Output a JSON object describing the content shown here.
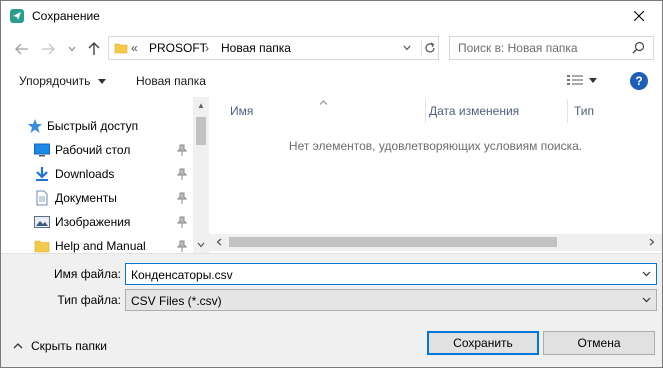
{
  "window": {
    "title": "Сохранение"
  },
  "address": {
    "crumbs": [
      "PROSOFT",
      "Новая папка"
    ]
  },
  "search": {
    "placeholder": "Поиск в: Новая папка"
  },
  "toolbar": {
    "organize_label": "Упорядочить",
    "new_folder_label": "Новая папка"
  },
  "nav": {
    "items": [
      {
        "label": "Быстрый доступ",
        "icon": "star-icon",
        "pinned": false
      },
      {
        "label": "Рабочий стол",
        "icon": "desktop-icon",
        "pinned": true
      },
      {
        "label": "Downloads",
        "icon": "download-arrow-icon",
        "pinned": true
      },
      {
        "label": "Документы",
        "icon": "documents-icon",
        "pinned": true
      },
      {
        "label": "Изображения",
        "icon": "pictures-icon",
        "pinned": true
      },
      {
        "label": "Help and Manual",
        "icon": "folder-icon",
        "pinned": true
      }
    ]
  },
  "filelist": {
    "columns": [
      "Имя",
      "Дата изменения",
      "Тип"
    ],
    "empty_message": "Нет элементов, удовлетворяющих условиям поиска."
  },
  "form": {
    "filename_label": "Имя файла:",
    "filename_value": "Конденсаторы.csv",
    "filetype_label": "Тип файла:",
    "filetype_value": "CSV Files (*.csv)"
  },
  "footer": {
    "hide_folders_label": "Скрыть папки",
    "save_label": "Сохранить",
    "cancel_label": "Отмена"
  },
  "colors": {
    "accent": "#0078d7",
    "help": "#1e5eb8",
    "folder": "#f5c94a"
  }
}
